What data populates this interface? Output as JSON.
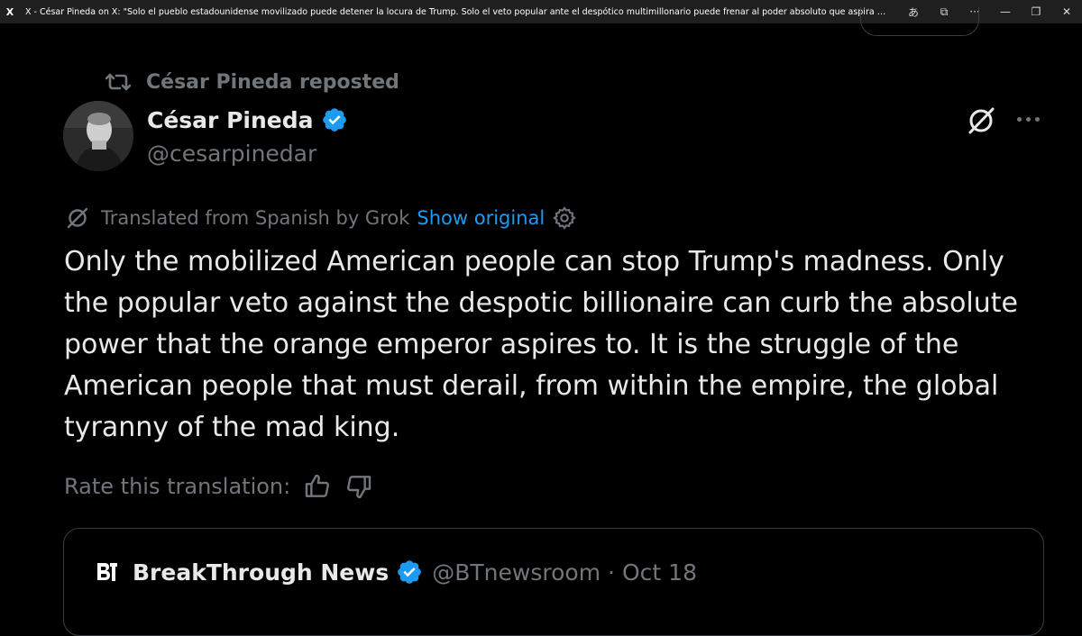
{
  "window": {
    "app_icon": "X",
    "title": "X - César Pineda on X: \"Solo el pueblo estadounidense movilizado puede detener la locura de Trump. Solo el veto popular ante el despótico multimillonario puede frenar al poder absoluto que aspira el emperador naranja. Es la lucha de...",
    "buttons": {
      "translate_icon": "あ",
      "cast_icon": "⧉",
      "more_icon": "···",
      "minimize": "—",
      "restore": "❐",
      "close": "✕"
    }
  },
  "repost": {
    "label": "César Pineda reposted",
    "icon": "repost-icon"
  },
  "author": {
    "name": "César Pineda",
    "handle": "@cesarpinedar",
    "verified": true
  },
  "translation": {
    "label": "Translated from Spanish by Grok",
    "show_original": "Show original"
  },
  "tweet": {
    "text": "Only the mobilized American people can stop Trump's madness. Only the popular veto against the despotic billionaire can curb the absolute power that the orange emperor aspires to. It is the struggle of the American people that must derail, from within the empire, the global tyranny of the mad king."
  },
  "rate": {
    "label": "Rate this translation:"
  },
  "quote": {
    "name": "BreakThrough News",
    "handle": "@BTnewsroom",
    "separator": "·",
    "date": "Oct 18",
    "verified": true
  },
  "colors": {
    "background": "#000000",
    "text": "#e7e9ea",
    "muted": "#71767b",
    "accent": "#1d9bf0",
    "border": "#3a3d40"
  }
}
